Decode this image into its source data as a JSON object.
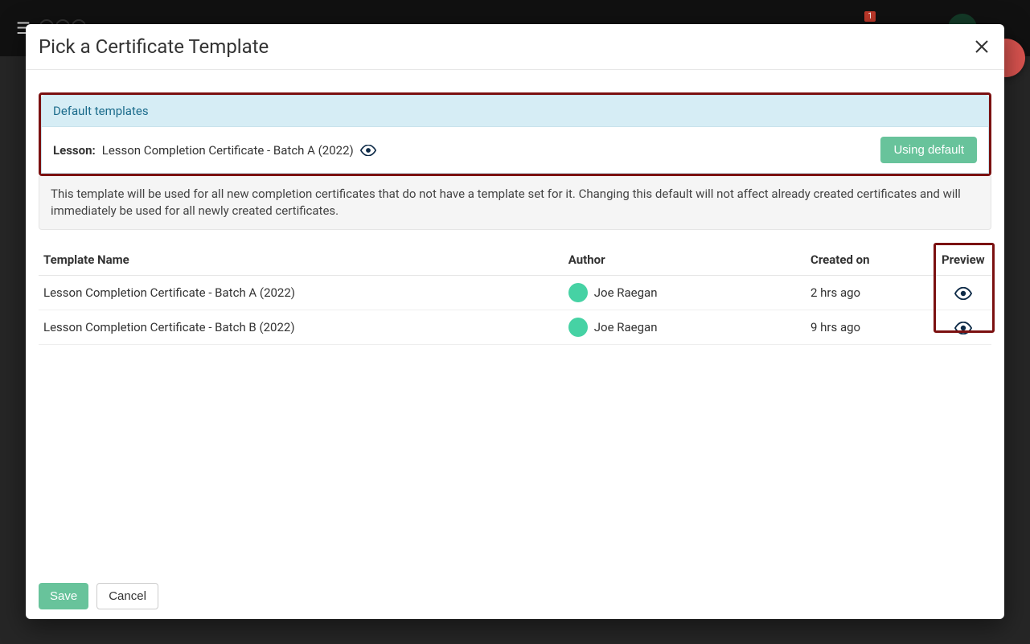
{
  "modal": {
    "title": "Pick a Certificate Template",
    "default_section": {
      "header": "Default templates",
      "lesson_label": "Lesson:",
      "lesson_value": "Lesson Completion Certificate - Batch A (2022)",
      "using_default_label": "Using default"
    },
    "info_text": "This template will be used for all new completion certificates that do not have a template set for it. Changing this default will not affect already created certificates and will immediately be used for all newly created certificates.",
    "table": {
      "columns": {
        "name": "Template Name",
        "author": "Author",
        "created": "Created on",
        "preview": "Preview"
      },
      "rows": [
        {
          "name": "Lesson Completion Certificate - Batch A (2022)",
          "author": "Joe Raegan",
          "created": "2 hrs ago"
        },
        {
          "name": "Lesson Completion Certificate - Batch B (2022)",
          "author": "Joe Raegan",
          "created": "9 hrs ago"
        }
      ]
    },
    "footer": {
      "save": "Save",
      "cancel": "Cancel"
    }
  },
  "topbar": {
    "notification_count": "1"
  }
}
